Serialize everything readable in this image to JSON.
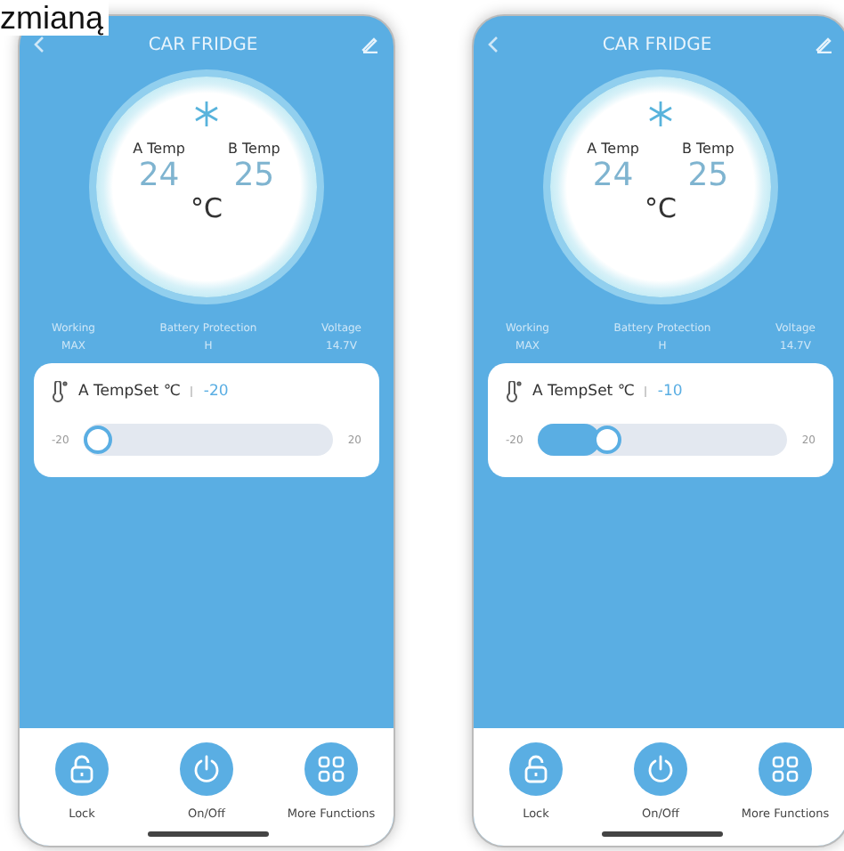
{
  "caption": "zmianą",
  "phones": [
    {
      "title": "CAR FRIDGE",
      "zones": [
        {
          "label": "A Temp",
          "value": "24"
        },
        {
          "label": "B Temp",
          "value": "25"
        }
      ],
      "unit": "°C",
      "stats": [
        {
          "label": "Working",
          "value": "MAX"
        },
        {
          "label": "Battery Protection",
          "value": "H"
        },
        {
          "label": "Voltage",
          "value": "14.7V"
        }
      ],
      "tempset": {
        "label": "A TempSet ℃",
        "value": "-20",
        "min": "-20",
        "max": "20",
        "level": 0
      },
      "actions": [
        {
          "kind": "lock",
          "label": "Lock"
        },
        {
          "kind": "power",
          "label": "On/Off"
        },
        {
          "kind": "grid",
          "label": "More Functions"
        }
      ]
    },
    {
      "title": "CAR FRIDGE",
      "zones": [
        {
          "label": "A Temp",
          "value": "24"
        },
        {
          "label": "B Temp",
          "value": "25"
        }
      ],
      "unit": "°C",
      "stats": [
        {
          "label": "Working",
          "value": "MAX"
        },
        {
          "label": "Battery Protection",
          "value": "H"
        },
        {
          "label": "Voltage",
          "value": "14.7V"
        }
      ],
      "tempset": {
        "label": "A TempSet ℃",
        "value": "-10",
        "min": "-20",
        "max": "20",
        "level": 0.25
      },
      "actions": [
        {
          "kind": "lock",
          "label": "Lock"
        },
        {
          "kind": "power",
          "label": "On/Off"
        },
        {
          "kind": "grid",
          "label": "More Functions"
        }
      ]
    }
  ]
}
